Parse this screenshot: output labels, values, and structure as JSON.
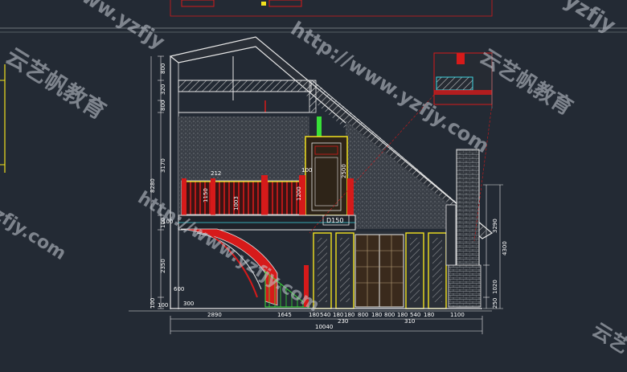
{
  "watermark": {
    "url_text": "http://www.yzfjy.com",
    "brand_cn": "云艺帆教育",
    "side_fragments": [
      "yzfjy",
      "ww.yzfjy",
      "zfjy.com"
    ],
    "corner_fragment": "云艺"
  },
  "dimensions": {
    "bottom_parts": [
      "2890",
      "1645",
      "180",
      "540",
      "180",
      "180",
      "800",
      "180",
      "800",
      "180",
      "540",
      "180",
      "1100"
    ],
    "bottom_total": "10040",
    "bottom_sub_left": "230",
    "bottom_sub_right": "310",
    "left_vertical": [
      "800",
      "320",
      "800",
      "3170",
      "8280",
      "100",
      "2350",
      "100"
    ],
    "inner_labels": [
      "212",
      "1150",
      "1003",
      "100",
      "2500",
      "1200",
      "100",
      "600",
      "300",
      "100"
    ],
    "right_vertical": [
      "3290",
      "4300",
      "1020",
      "250"
    ],
    "tag_label": "D150"
  },
  "colors": {
    "background": "#232a34",
    "line_white": "#e8e8e8",
    "accent_red": "#d61a1a",
    "accent_green": "#38e038",
    "accent_yellow": "#f2e21e",
    "accent_cyan": "#3fd6e0"
  }
}
